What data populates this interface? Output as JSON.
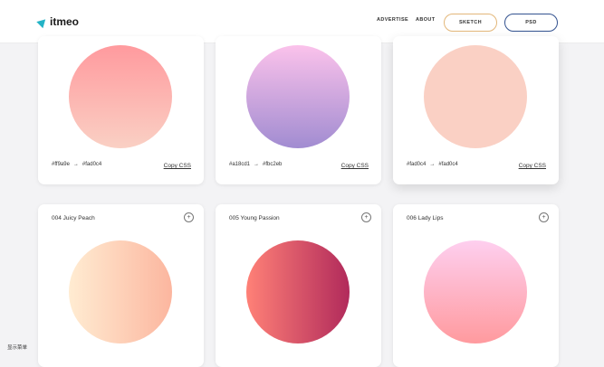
{
  "header": {
    "logo_text": "itmeo",
    "nav": {
      "advertise": "ADVERTISE",
      "about": "ABOUT"
    },
    "buttons": {
      "sketch": "SKETCH",
      "psd": "PSD"
    }
  },
  "cards": [
    {
      "from": "#ff9a9e",
      "to": "#fad0c4",
      "copy": "Copy CSS",
      "direction": "to bottom"
    },
    {
      "from": "#a18cd1",
      "to": "#fbc2eb",
      "copy": "Copy CSS",
      "direction": "to top"
    },
    {
      "from": "#fad0c4",
      "to": "#fad0c4",
      "copy": "Copy CSS",
      "direction": "to top"
    },
    {
      "title": "004 Juicy Peach",
      "from": "#ffecd2",
      "to": "#fcb69f",
      "direction": "to right"
    },
    {
      "title": "005 Young Passion",
      "from": "#ff8177",
      "to": "#b12a5b",
      "direction": "to right"
    },
    {
      "title": "006 Lady Lips",
      "from": "#ff9a9e",
      "to": "#fecfef",
      "direction": "to top"
    }
  ],
  "arrow_glyph": "→",
  "plus_glyph": "+",
  "footer_label": "显示菜单",
  "colors": {
    "background": "#f3f3f5",
    "logo_mark": "#24b3c6",
    "sketch_border": "#e3b77a",
    "psd_border": "#33528f"
  }
}
